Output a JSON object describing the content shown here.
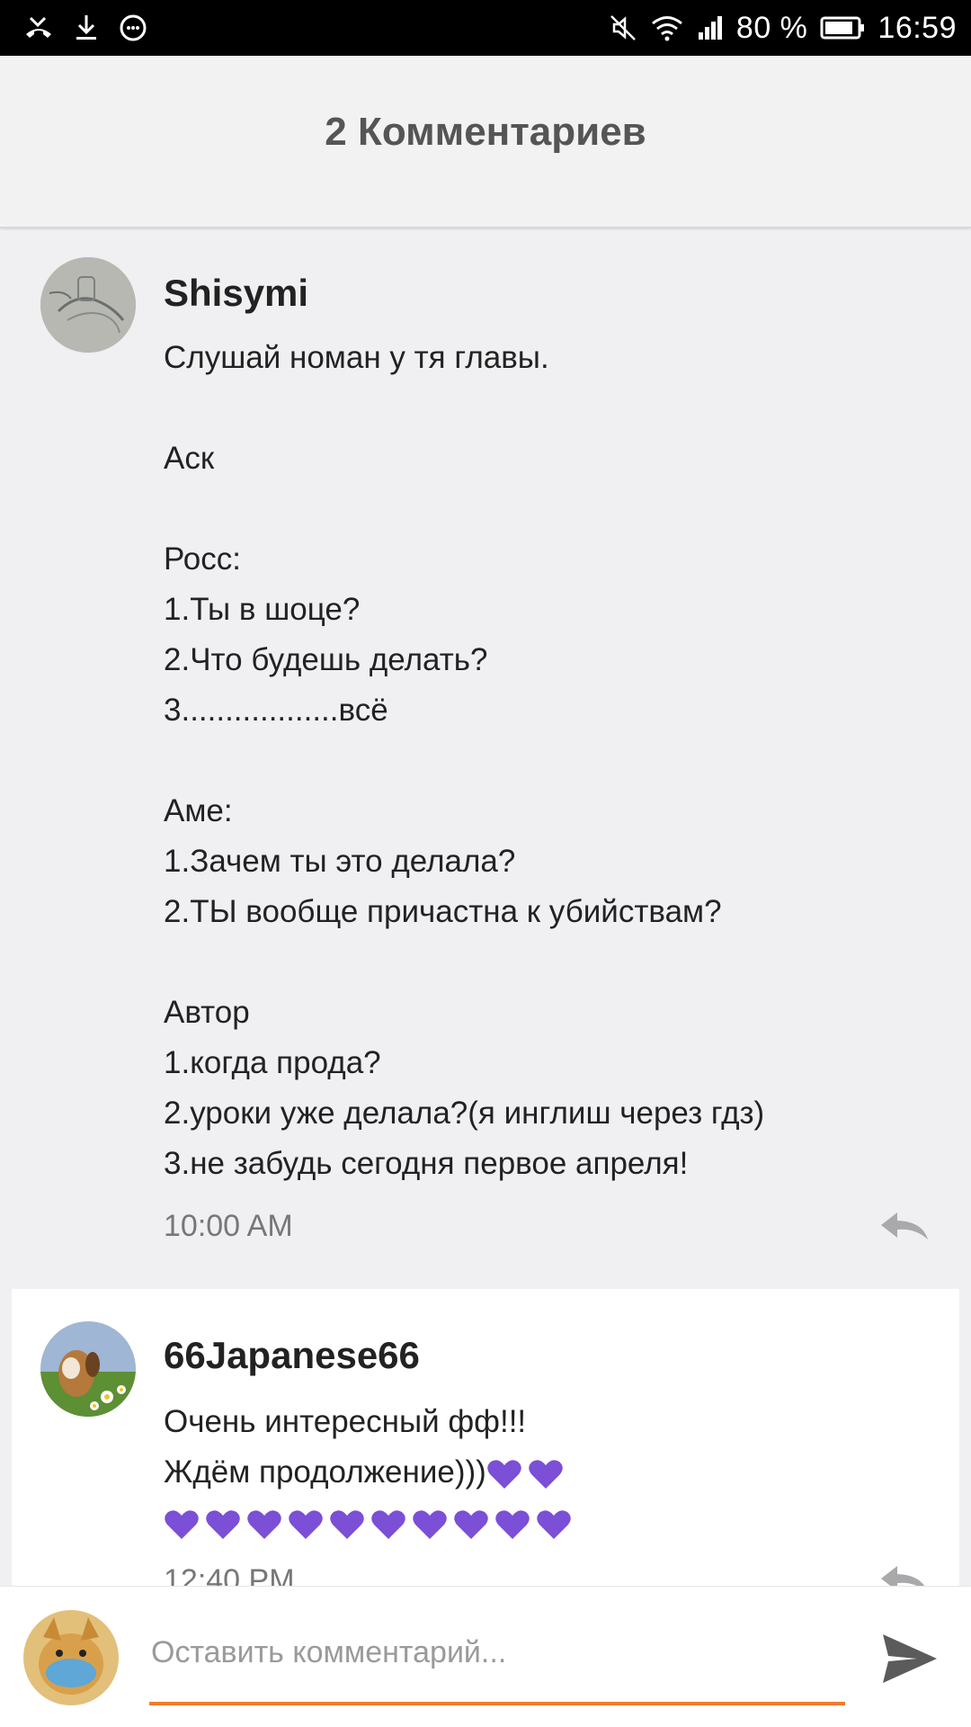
{
  "status_bar": {
    "battery": "80 %",
    "time": "16:59",
    "icons": [
      "missed-call-icon",
      "download-icon",
      "messenger-icon",
      "mute-icon",
      "wifi-icon",
      "signal-icon",
      "battery-icon"
    ]
  },
  "header": {
    "title": "2 Комментариев"
  },
  "comments": [
    {
      "author": "Shisymi",
      "lines": [
        "Слушай номан у тя главы.",
        "",
        "Аск",
        "",
        "Росс:",
        "1.Ты в шоце?",
        "2.Что будешь делать?",
        "3..................всё",
        "",
        "Аме:",
        "1.Зачем ты это делала?",
        "2.ТЫ вообще причастна к убийствам?",
        "",
        "Автор",
        "1.когда прода?",
        "2.уроки уже делала?(я инглиш через гдз)",
        "3.не забудь сегодня первое апреля!"
      ],
      "time": "10:00 AM"
    },
    {
      "author": "66Japanese66",
      "lines": [
        "Очень интересный фф!!!",
        "Ждём продолжение)))"
      ],
      "hearts_line2": 2,
      "hearts_line3": 10,
      "time": "12:40 PM"
    }
  ],
  "input": {
    "placeholder": "Оставить комментарий..."
  },
  "colors": {
    "accent": "#f07b2c",
    "heart": "#7b4fd6",
    "header_bg": "#f3f2f3",
    "page_bg": "#f0eff2"
  }
}
